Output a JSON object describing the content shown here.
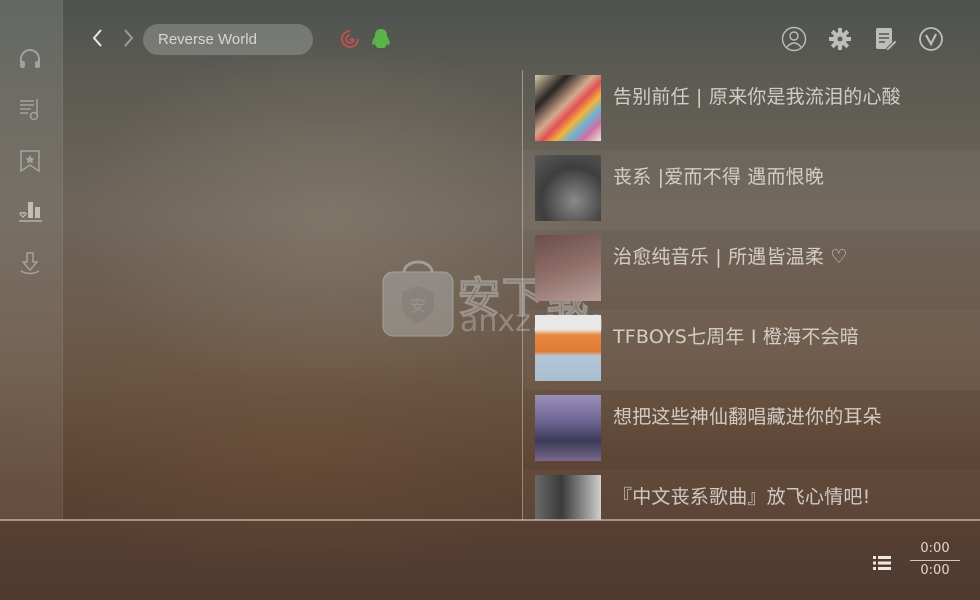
{
  "sidebar": {
    "items": [
      {
        "icon": "headphones-icon",
        "label": "Listen"
      },
      {
        "icon": "music-list-icon",
        "label": "Playlist"
      },
      {
        "icon": "bookmark-star-icon",
        "label": "Favorites"
      },
      {
        "icon": "chart-bars-icon",
        "label": "Charts"
      },
      {
        "icon": "download-icon",
        "label": "Downloads"
      }
    ]
  },
  "topbar": {
    "search_value": "Reverse World",
    "sources": [
      {
        "icon": "netease-icon",
        "color": "#c0514f"
      },
      {
        "icon": "qq-penguin-icon",
        "color": "#5ab44a"
      }
    ],
    "tools": [
      {
        "icon": "user-icon"
      },
      {
        "icon": "gear-icon"
      },
      {
        "icon": "edit-note-icon"
      },
      {
        "icon": "vip-v-icon"
      }
    ]
  },
  "playlist": [
    {
      "title": "告别前任 | 原来你是我流泪的心酸"
    },
    {
      "title": "丧系 |爱而不得 遇而恨晚"
    },
    {
      "title": "治愈纯音乐 | 所遇皆温柔 ♡"
    },
    {
      "title": "TFBOYS七周年 I 橙海不会暗"
    },
    {
      "title": "想把这些神仙翻唱藏进你的耳朵"
    },
    {
      "title": "『中文丧系歌曲』放飞心情吧!"
    }
  ],
  "watermark": {
    "text": "安下载",
    "url": "anxz.com"
  },
  "player": {
    "current_time": "0:00",
    "total_time": "0:00"
  }
}
